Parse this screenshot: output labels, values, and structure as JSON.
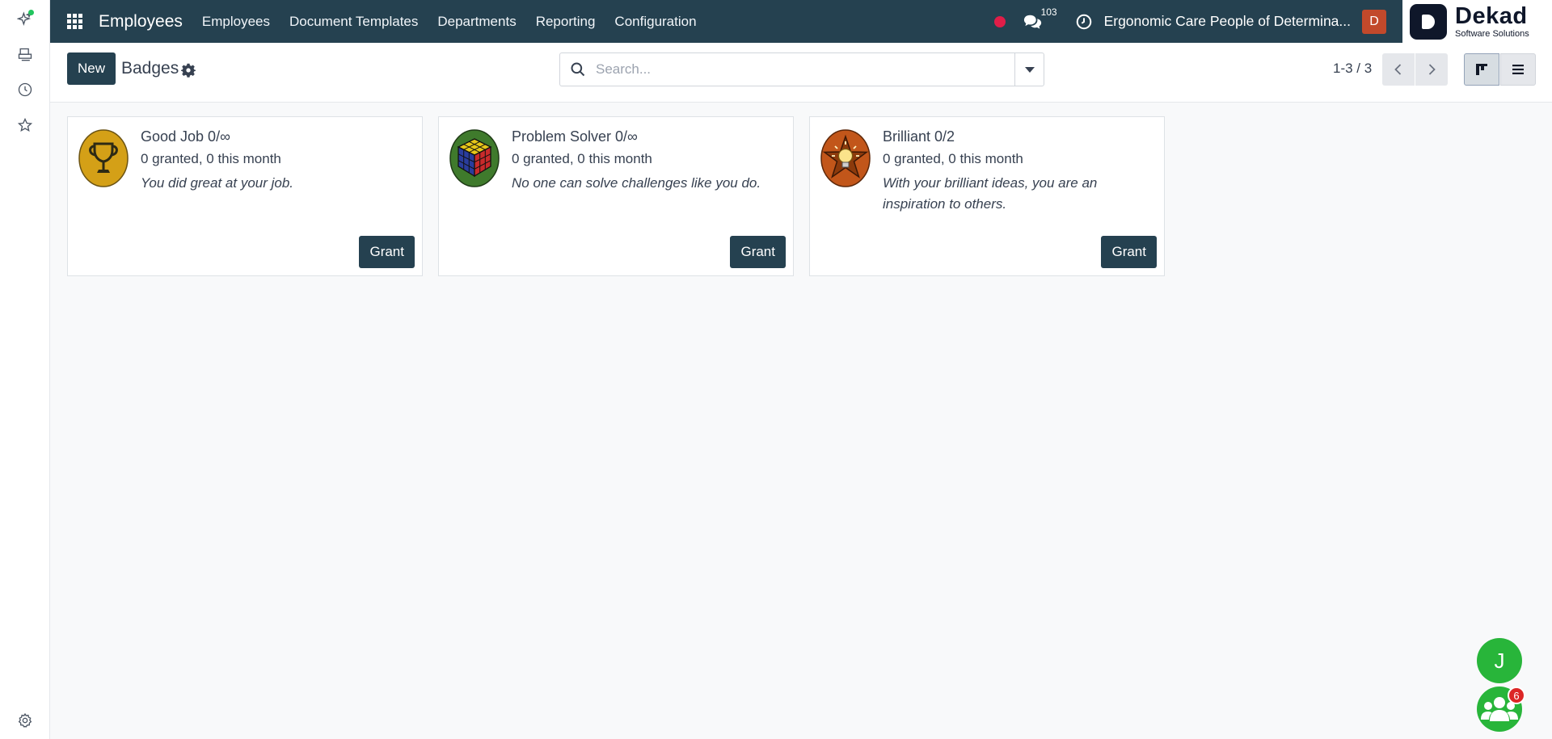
{
  "navbar": {
    "brand": "Employees",
    "menu": [
      "Employees",
      "Document Templates",
      "Departments",
      "Reporting",
      "Configuration"
    ],
    "chat_count": "103",
    "company": "Ergonomic Care People of Determina...",
    "user_initial": "D",
    "logo_name": "Dekad",
    "logo_sub": "Software Solutions"
  },
  "leftbar": {
    "icons": [
      "sparkle-icon",
      "printer-icon",
      "clock-icon",
      "star-icon",
      "settings-gear-icon"
    ]
  },
  "control": {
    "new_label": "New",
    "title": "Badges",
    "search_placeholder": "Search...",
    "pager": "1-3 / 3"
  },
  "badges": [
    {
      "title": "Good Job 0/∞",
      "stats": "0 granted, 0 this month",
      "description": "You did great at your job.",
      "grant_label": "Grant",
      "icon": "trophy-badge",
      "color": "#d4a017"
    },
    {
      "title": "Problem Solver 0/∞",
      "stats": "0 granted, 0 this month",
      "description": "No one can solve challenges like you do.",
      "grant_label": "Grant",
      "icon": "rubiks-cube-badge",
      "color": "#3f7a2c"
    },
    {
      "title": "Brilliant 0/2",
      "stats": "0 granted, 0 this month",
      "description": "With your brilliant ideas, you are an inspiration to others.",
      "grant_label": "Grant",
      "icon": "lightbulb-star-badge",
      "color": "#c2561a"
    }
  ],
  "bubbles": {
    "user_initial": "J",
    "team_count": "6"
  },
  "colors": {
    "navbar": "#254150",
    "primary_button": "#254150",
    "record_dot": "#e11d48",
    "bubble": "#28b53a"
  }
}
